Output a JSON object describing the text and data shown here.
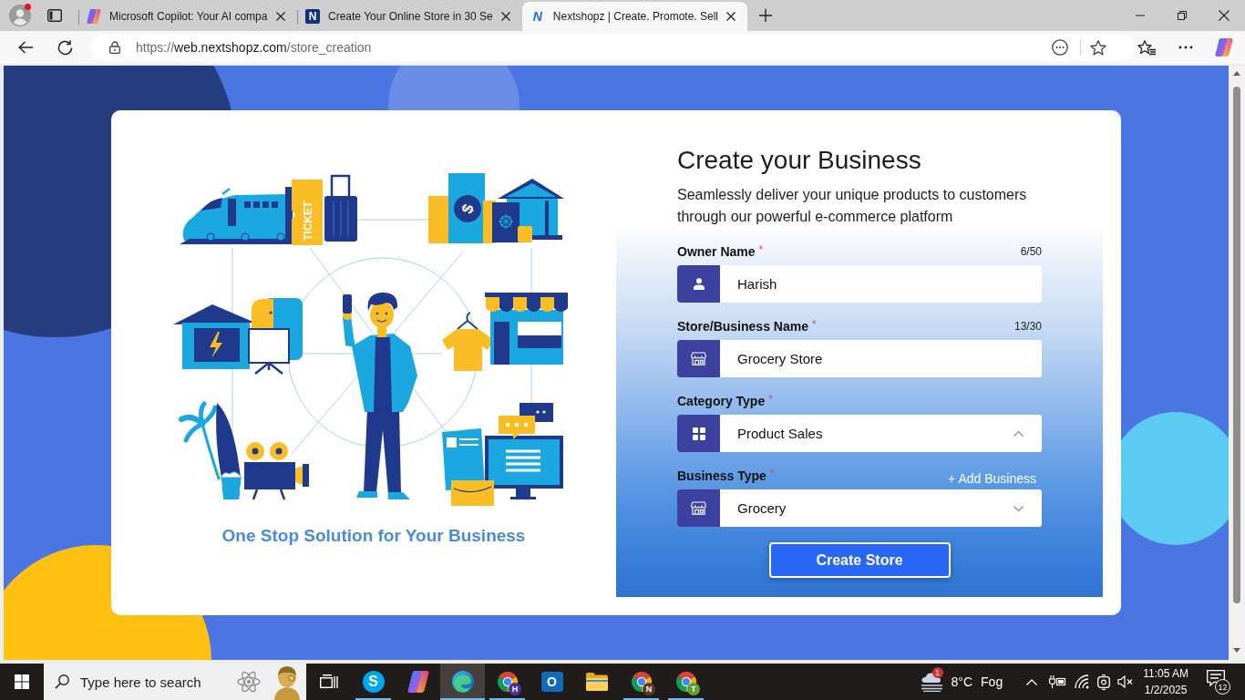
{
  "browser": {
    "profile_alert": true,
    "tabs": [
      {
        "kind": "copilot",
        "title": "Microsoft Copilot: Your AI compa",
        "selected": false
      },
      {
        "kind": "letter",
        "favicon_text": "N",
        "title": "Create Your Online Store in 30 Se",
        "selected": false
      },
      {
        "kind": "brand",
        "favicon_text": "N",
        "title": "Nextshopz | Create. Promote. Sell",
        "selected": true
      }
    ],
    "address": {
      "scheme": "https://",
      "host": "web.nextshopz.com",
      "path": "/store_creation"
    }
  },
  "hero": {
    "ticket_text": "TICKET",
    "coin_text": "$",
    "tagline": "One Stop Solution for Your Business"
  },
  "form": {
    "title": "Create your Business",
    "subtitle": "Seamlessly deliver your unique products to customers through our powerful e-commerce platform",
    "fields": [
      {
        "kind": "text",
        "label": "Owner Name",
        "required_mark": "*",
        "counter": "6/50",
        "value": "Harish"
      },
      {
        "kind": "text",
        "label": "Store/Business Name",
        "required_mark": "*",
        "counter": "13/30",
        "value": "Grocery Store"
      },
      {
        "kind": "select",
        "label": "Category Type",
        "required_mark": "*",
        "value": "Product Sales",
        "expanded": true
      },
      {
        "kind": "select",
        "label": "Business Type",
        "required_mark": "*",
        "link": "+ Add Business",
        "value": "Grocery",
        "expanded": false
      }
    ],
    "submit": "Create Store"
  },
  "taskbar": {
    "search_placeholder": "Type here to search",
    "apps": [
      {
        "kind": "task_view",
        "running": false,
        "selected": false
      },
      {
        "kind": "skype",
        "glyph": "S",
        "running": true,
        "selected": false
      },
      {
        "kind": "copilot",
        "running": false,
        "selected": false
      },
      {
        "kind": "edge",
        "running": true,
        "selected": true
      },
      {
        "kind": "chrome",
        "badge": "H",
        "color": "#4a2f9e",
        "running": true,
        "selected": false
      },
      {
        "kind": "outlook",
        "glyph": "O",
        "running": false,
        "selected": false
      },
      {
        "kind": "files",
        "running": false,
        "selected": false
      },
      {
        "kind": "chrome",
        "badge": "N",
        "color": "#5b3b30",
        "running": true,
        "selected": false
      },
      {
        "kind": "chrome",
        "badge": "T",
        "color": "#5e9e35",
        "running": true,
        "selected": false
      }
    ],
    "weather": {
      "alert_count": "1",
      "temperature": "8°C",
      "condition": "Fog"
    },
    "time": "11:05 AM",
    "date": "1/2/2025",
    "notification_count": "12"
  }
}
